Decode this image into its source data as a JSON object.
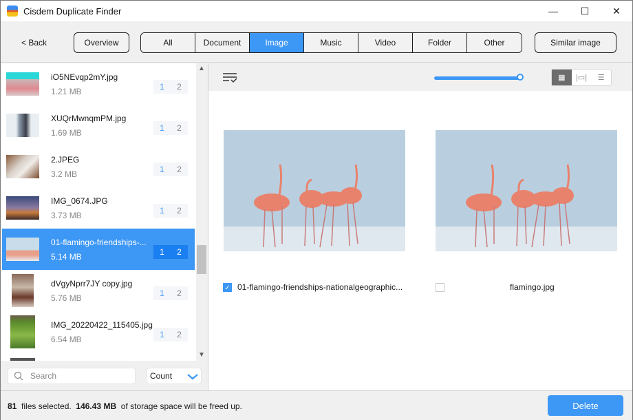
{
  "window": {
    "title": "Cisdem Duplicate Finder",
    "minimize": "—",
    "maximize": "☐",
    "close": "✕"
  },
  "toolbar": {
    "back": "< Back",
    "overview": "Overview",
    "similar": "Similar image",
    "tabs": [
      {
        "label": "All"
      },
      {
        "label": "Document"
      },
      {
        "label": "Image",
        "active": true
      },
      {
        "label": "Music"
      },
      {
        "label": "Video"
      },
      {
        "label": "Folder"
      },
      {
        "label": "Other"
      }
    ]
  },
  "files": [
    {
      "name": "iO5NEvqp2mY.jpg",
      "size": "1.21 MB",
      "b1": "1",
      "b2": "2"
    },
    {
      "name": "XUQrMwnqmPM.jpg",
      "size": "1.69 MB",
      "b1": "1",
      "b2": "2"
    },
    {
      "name": "2.JPEG",
      "size": "3.2 MB",
      "b1": "1",
      "b2": "2"
    },
    {
      "name": "IMG_0674.JPG",
      "size": "3.73 MB",
      "b1": "1",
      "b2": "2"
    },
    {
      "name": "01-flamingo-friendships-...",
      "size": "5.14 MB",
      "b1": "1",
      "b2": "2",
      "selected": true
    },
    {
      "name": "dVgyNprr7JY copy.jpg",
      "size": "5.76 MB",
      "b1": "1",
      "b2": "2"
    },
    {
      "name": "IMG_20220422_115405.jpg",
      "size": "6.54 MB",
      "b1": "1",
      "b2": "2"
    }
  ],
  "search": {
    "placeholder": "Search"
  },
  "sort": {
    "value": "Count"
  },
  "preview": {
    "slider_value": 100,
    "items": [
      {
        "caption": "01-flamingo-friendships-nationalgeographic...",
        "checked": true
      },
      {
        "caption": "flamingo.jpg",
        "checked": false
      }
    ]
  },
  "status": {
    "count": "81",
    "count_text": "files selected.",
    "size": "146.43 MB",
    "size_text": "of storage space will be freed up.",
    "delete": "Delete"
  }
}
